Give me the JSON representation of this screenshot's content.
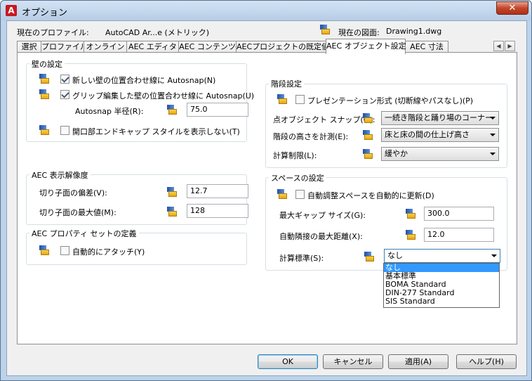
{
  "window": {
    "title": "オプション",
    "app_icon_glyph": "A",
    "close_glyph": "✕"
  },
  "header": {
    "profile_label": "現在のプロファイル:",
    "profile_value": "AutoCAD Ar...e (メトリック)",
    "drawing_label": "現在の図面:",
    "drawing_value": "Drawing1.dwg"
  },
  "tabs": [
    {
      "label": "選択"
    },
    {
      "label": "プロファイル"
    },
    {
      "label": "オンライン"
    },
    {
      "label": "AEC エディタ"
    },
    {
      "label": "AEC コンテンツ"
    },
    {
      "label": "AECプロジェクトの既定値"
    },
    {
      "label": "AEC オブジェクト設定",
      "active": true
    },
    {
      "label": "AEC 寸法"
    }
  ],
  "tab_scroll": {
    "left_glyph": "◀",
    "right_glyph": "▶"
  },
  "wall": {
    "title": "壁の設定",
    "autosnap_new_label": "新しい壁の位置合わせ線に Autosnap(N)",
    "autosnap_new_checked": true,
    "autosnap_grip_label": "グリップ編集した壁の位置合わせ線に Autosnap(U)",
    "autosnap_grip_checked": true,
    "radius_label": "Autosnap 半径(R):",
    "radius_value": "75.0",
    "endcap_label": "開口部エンドキャップ スタイルを表示しない(T)",
    "endcap_checked": false
  },
  "resolution": {
    "title": "AEC 表示解像度",
    "deviation_label": "切り子面の偏差(V):",
    "deviation_value": "12.7",
    "max_label": "切り子面の最大値(M):",
    "max_value": "128"
  },
  "propset": {
    "title": "AEC プロパティ セットの定義",
    "attach_label": "自動的にアタッチ(Y)",
    "attach_checked": false
  },
  "stair": {
    "title": "階段設定",
    "presentation_label": "プレゼンテーション形式 (切断線やパスなし)(P)",
    "presentation_checked": false,
    "snap_label": "点オブジェクト スナップ(O):",
    "snap_value": "一続き階段と踊り場のコーナー",
    "height_label": "階段の高さを計測(E):",
    "height_value": "床と床の間の仕上げ高さ",
    "limit_label": "計算制限(L):",
    "limit_value": "緩やか"
  },
  "space": {
    "title": "スペースの設定",
    "auto_label": "自動調整スペースを自動的に更新(D)",
    "auto_checked": false,
    "gap_label": "最大ギャップ サイズ(G):",
    "gap_value": "300.0",
    "adj_label": "自動隣接の最大距離(X):",
    "adj_value": "12.0",
    "standard_label": "計算標準(S):",
    "standard_value": "なし",
    "standard_options": [
      "なし",
      "基本標準",
      "BOMA Standard",
      "DIN-277 Standard",
      "SIS Standard"
    ]
  },
  "buttons": {
    "ok": "OK",
    "cancel": "キャンセル",
    "apply": "適用(A)",
    "help": "ヘルプ(H)"
  }
}
